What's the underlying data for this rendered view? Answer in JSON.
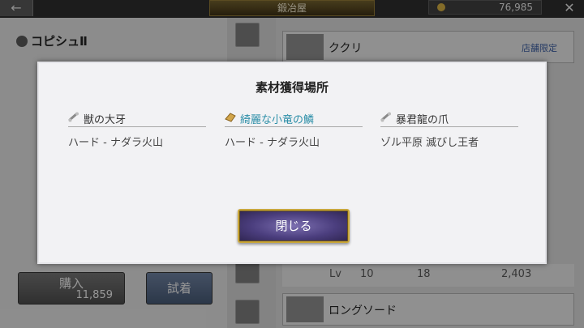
{
  "header": {
    "title": "鍛冶屋",
    "coins": "76,985"
  },
  "background": {
    "item_name": "コピシュⅡ",
    "list": [
      {
        "name": "ククリ",
        "tag": "店舗限定"
      },
      {
        "name": "ロングソード",
        "tag": ""
      }
    ],
    "stats": {
      "lv_label": "Lv",
      "lv": "10",
      "atk": "18",
      "price": "2,403"
    },
    "buy_label": "購入",
    "buy_price": "11,859",
    "try_label": "試着"
  },
  "modal": {
    "title": "素材獲得場所",
    "sources": [
      {
        "material": "獣の大牙",
        "location": "ハード - ナダラ火山",
        "highlighted": false,
        "icon": "bone-icon"
      },
      {
        "material": "綺麗な小竜の鱗",
        "location": "ハード - ナダラ火山",
        "highlighted": true,
        "icon": "scale-icon"
      },
      {
        "material": "暴君龍の爪",
        "location": "ゾル平原 滅びし王者",
        "highlighted": false,
        "icon": "bone-icon"
      }
    ],
    "close_label": "閉じる"
  },
  "colors": {
    "highlight_text": "#2d8fa8",
    "button_gold": "#c9a73c",
    "button_purple": "#4b3e7e"
  }
}
